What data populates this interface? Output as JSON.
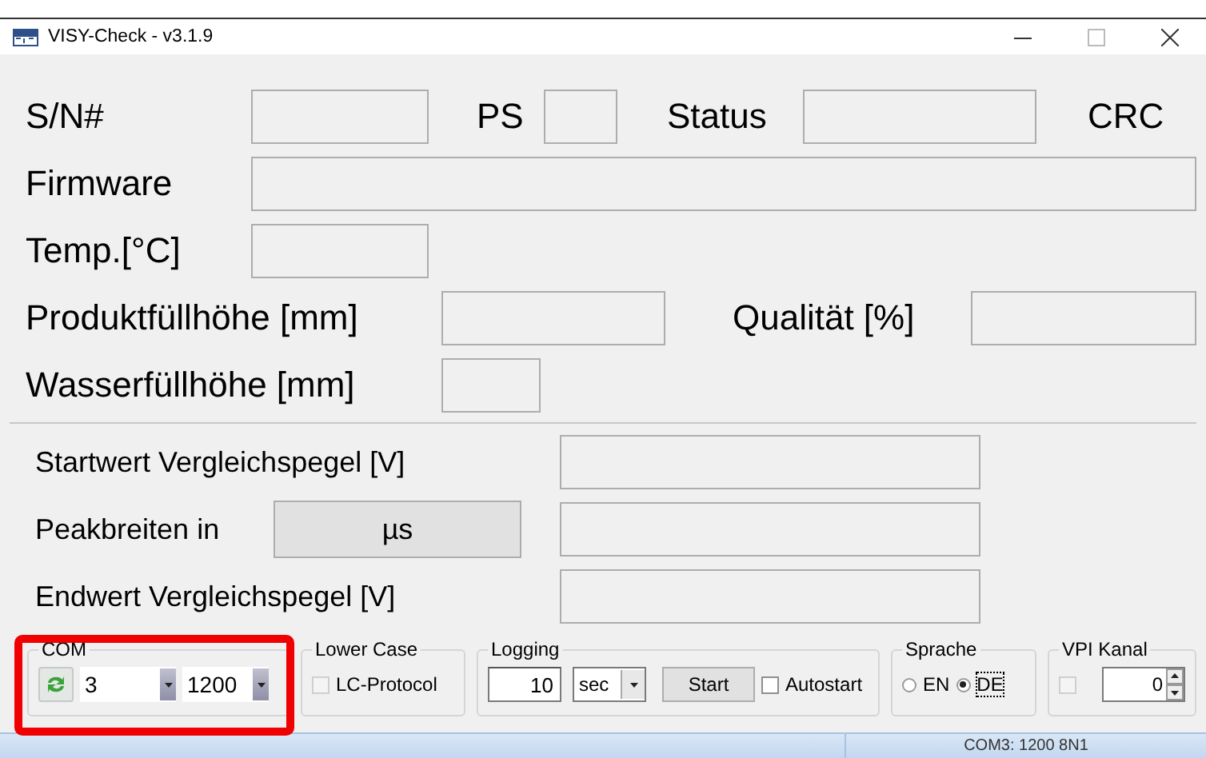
{
  "window": {
    "title": "VISY-Check - v3.1.9"
  },
  "measurements": {
    "sn": "S/N#",
    "ps": "PS",
    "status": "Status",
    "crc": "CRC",
    "firmware": "Firmware",
    "temp": "Temp.[°C]",
    "product_level": "Produktfüllhöhe [mm]",
    "quality": "Qualität [%]",
    "water_level": "Wasserfüllhöhe [mm]"
  },
  "comparison": {
    "start_label": "Startwert Vergleichspegel [V]",
    "peak_label": "Peakbreiten in",
    "unit_button": "µs",
    "end_label": "Endwert Vergleichspegel [V]"
  },
  "com": {
    "title": "COM",
    "port": "3",
    "baud": "1200"
  },
  "lower_case": {
    "title": "Lower Case",
    "option": {
      "label": "LC-Protocol",
      "checked": false,
      "disabled": true
    }
  },
  "logging": {
    "title": "Logging",
    "interval": "10",
    "unit": "sec",
    "start_button": "Start",
    "autostart": {
      "label": "Autostart",
      "checked": false,
      "disabled": false
    }
  },
  "language": {
    "title": "Sprache",
    "options": [
      {
        "label": "EN",
        "selected": false
      },
      {
        "label": "DE",
        "selected": true
      }
    ]
  },
  "vpi": {
    "title": "VPI Kanal",
    "enabled": {
      "checked": false,
      "disabled": true
    },
    "channel": "0"
  },
  "status_bar": {
    "connection": "COM3: 1200 8N1"
  }
}
